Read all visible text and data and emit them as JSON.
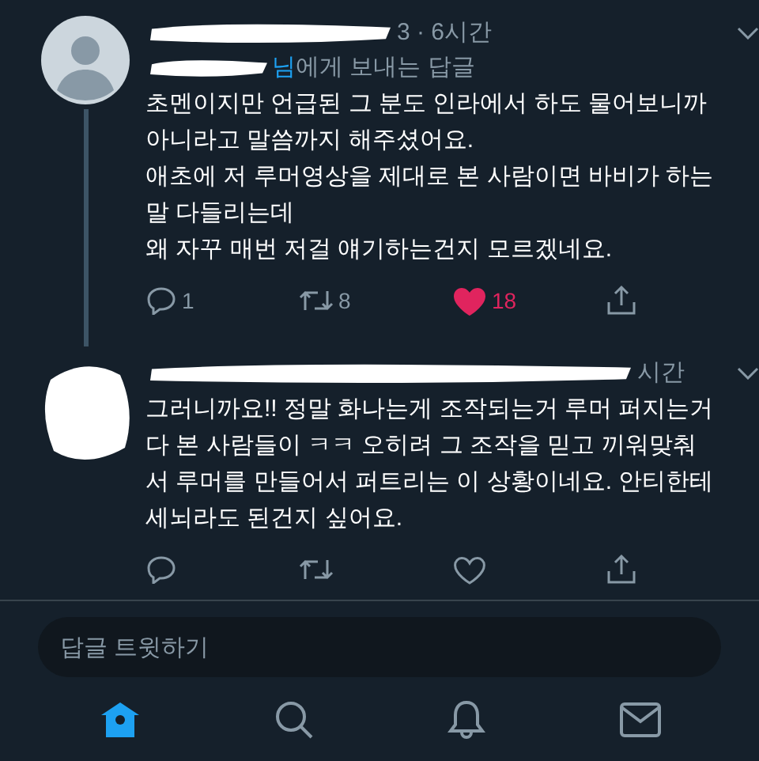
{
  "tweets": [
    {
      "avatar": {
        "kind": "default"
      },
      "time": "3 · 6시간",
      "reply_to": {
        "mention_tail": "님",
        "text": "에게 보내는 답글"
      },
      "thread_line": true,
      "lines": [
        "초멘이지만 언급된 그 분도 인라에서 하도 물어보니까",
        "아니라고 말씀까지 해주셨어요.",
        "애초에 저 루머영상을 제대로 본 사람이면 바비가 하는",
        "말 다들리는데",
        "왜 자꾸 매번 저걸 얘기하는건지 모르겠네요."
      ],
      "actions": {
        "replies": "1",
        "retweets": "8",
        "likes": "18",
        "liked": true
      }
    },
    {
      "avatar": {
        "kind": "redacted"
      },
      "time": "시간",
      "thread_line": false,
      "lines": [
        "그러니까요!! 정말 화나는게 조작되는거 루머 퍼지는거",
        "다 본 사람들이 ㅋㅋ 오히려 그 조작을 믿고 끼워맞춰",
        "서 루머를 만들어서 퍼트리는 이 상황이네요. 안티한테",
        "세뇌라도 된건지 싶어요."
      ],
      "actions": {
        "liked": false
      }
    }
  ],
  "reply_field": {
    "placeholder": "답글 트윗하기"
  },
  "nav": [
    {
      "kind": "home",
      "selected": true
    },
    {
      "kind": "search",
      "selected": false
    },
    {
      "kind": "notifications",
      "selected": false
    },
    {
      "kind": "messages",
      "selected": false
    }
  ]
}
